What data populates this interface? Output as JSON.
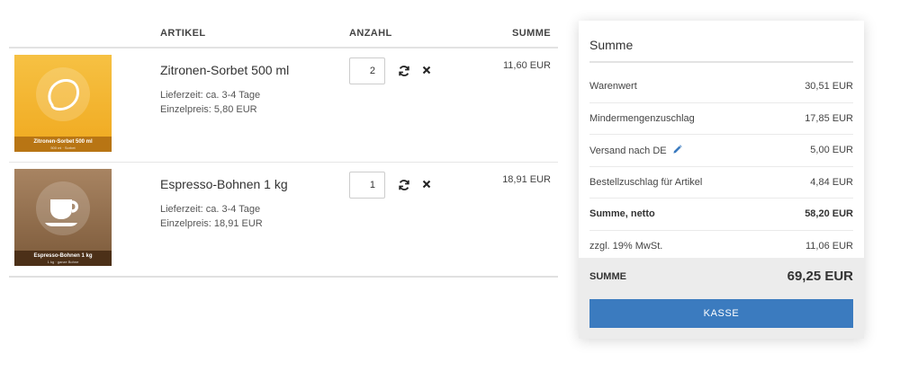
{
  "cart": {
    "headers": {
      "article": "ARTIKEL",
      "quantity": "ANZAHL",
      "sum": "SUMME"
    },
    "items": [
      {
        "title": "Zitronen-Sorbet 500 ml",
        "delivery": "Lieferzeit: ca. 3-4 Tage",
        "unit_price": "Einzelpreis: 5,80 EUR",
        "quantity": "2",
        "sum": "11,60 EUR",
        "image_label": "Zitronen-Sorbet 500 ml",
        "image_sub": "500 ml · Sorbet",
        "icon": "lemon-icon",
        "color": "#f0a91f"
      },
      {
        "title": "Espresso-Bohnen 1 kg",
        "delivery": "Lieferzeit: ca. 3-4 Tage",
        "unit_price": "Einzelpreis: 18,91 EUR",
        "quantity": "1",
        "sum": "18,91 EUR",
        "image_label": "Espresso-Bohnen 1 kg",
        "image_sub": "1 kg · ganze Bohne",
        "icon": "coffee-cup-icon",
        "color": "#8b6948"
      }
    ],
    "icons": {
      "update": "refresh-icon",
      "remove": "close-icon"
    }
  },
  "summary": {
    "title": "Summe",
    "lines": [
      {
        "label": "Warenwert",
        "value": "30,51 EUR"
      },
      {
        "label": "Mindermengenzuschlag",
        "value": "17,85 EUR"
      },
      {
        "label": "Versand nach DE",
        "value": "5,00 EUR"
      },
      {
        "label": "Bestellzuschlag für Artikel",
        "value": "4,84 EUR"
      },
      {
        "label": "Summe, netto",
        "value": "58,20 EUR"
      },
      {
        "label": "zzgl. 19% MwSt.",
        "value": "11,06 EUR"
      }
    ],
    "total_label": "SUMME",
    "total_value": "69,25 EUR",
    "checkout_label": "KASSE",
    "accent_color": "#3b7bbf"
  }
}
